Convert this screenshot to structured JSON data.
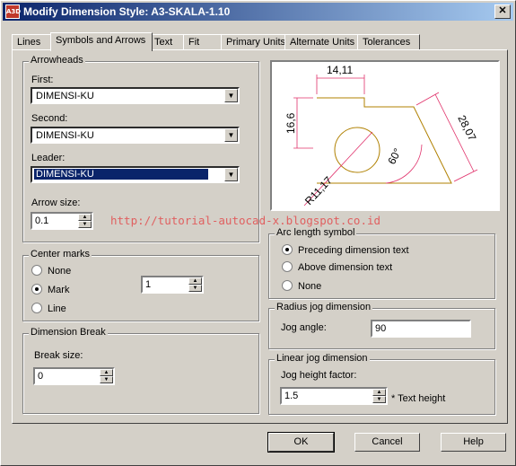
{
  "window": {
    "title": "Modify Dimension Style: A3-SKALA-1.10",
    "app_icon_text": "A3D"
  },
  "tabs": [
    {
      "label": "Lines"
    },
    {
      "label": "Symbols and Arrows"
    },
    {
      "label": "Text"
    },
    {
      "label": "Fit"
    },
    {
      "label": "Primary Units"
    },
    {
      "label": "Alternate Units"
    },
    {
      "label": "Tolerances"
    }
  ],
  "arrowheads": {
    "legend": "Arrowheads",
    "first_label": "First:",
    "first_value": "DIMENSI-KU",
    "second_label": "Second:",
    "second_value": "DIMENSI-KU",
    "leader_label": "Leader:",
    "leader_value": "DIMENSI-KU",
    "size_label": "Arrow size:",
    "size_value": "0.1"
  },
  "center_marks": {
    "legend": "Center marks",
    "options": [
      "None",
      "Mark",
      "Line"
    ],
    "selected": "Mark",
    "size_value": "1"
  },
  "dimension_break": {
    "legend": "Dimension Break",
    "label": "Break size:",
    "value": "0"
  },
  "preview": {
    "dim_top": "14,11",
    "dim_left": "16,6",
    "dim_right": "28,07",
    "dim_radius": "R11,17",
    "dim_angle": "60°"
  },
  "watermark": "http://tutorial-autocad-x.blogspot.co.id",
  "arc_length": {
    "legend": "Arc length symbol",
    "options": [
      "Preceding dimension text",
      "Above dimension text",
      "None"
    ],
    "selected": "Preceding dimension text"
  },
  "radius_jog": {
    "legend": "Radius jog dimension",
    "label": "Jog angle:",
    "value": "90"
  },
  "linear_jog": {
    "legend": "Linear jog dimension",
    "label": "Jog height factor:",
    "value": "1.5",
    "suffix": "* Text height"
  },
  "buttons": {
    "ok": "OK",
    "cancel": "Cancel",
    "help": "Help"
  },
  "colors": {
    "geometry": "#b08000",
    "dimension": "#e0306a",
    "titlebar": "#0a246a"
  }
}
